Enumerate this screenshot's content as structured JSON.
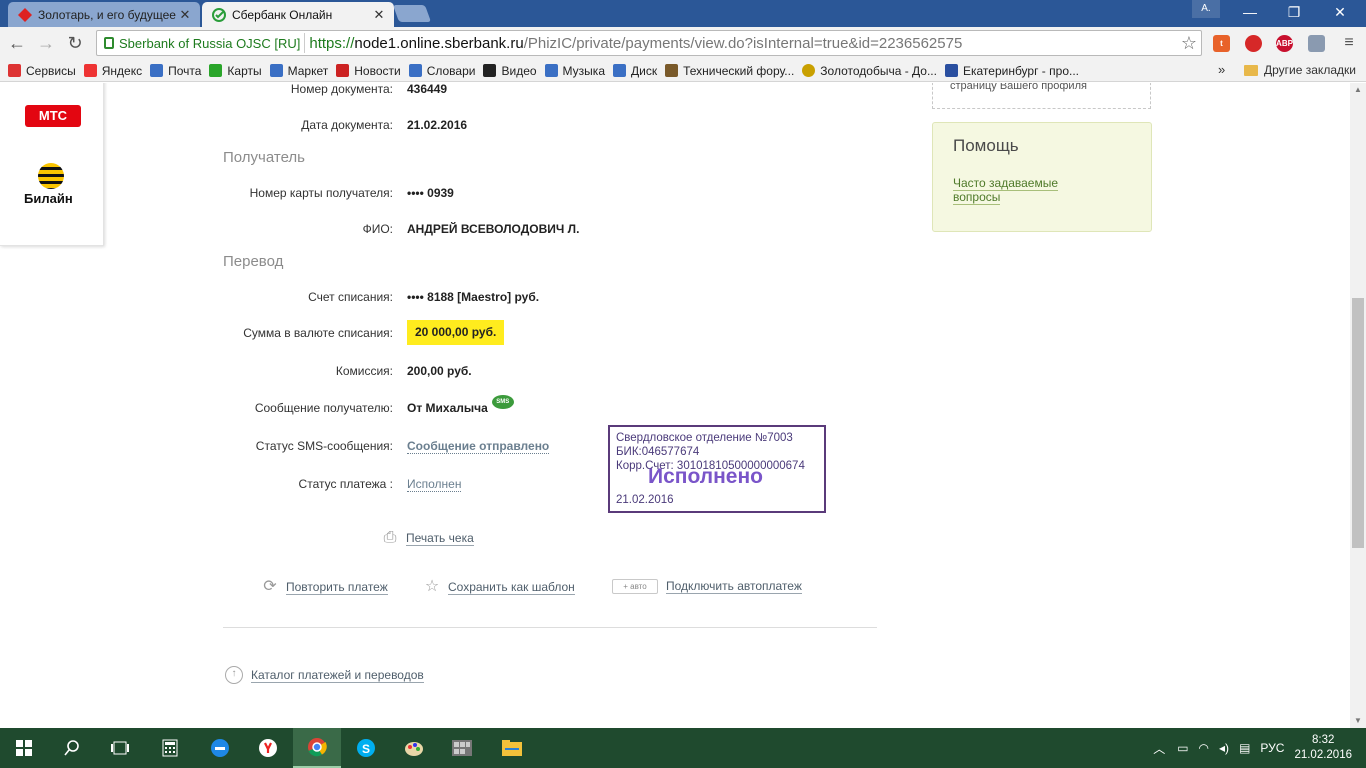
{
  "browser": {
    "tabs": [
      {
        "title": "Золотарь, и его будущее",
        "active": false
      },
      {
        "title": "Сбербанк Онлайн",
        "active": true
      }
    ],
    "profile": "A.",
    "window_controls": {
      "minimize": "—",
      "restore": "❐",
      "close": "✕"
    },
    "ev_cert": "Sberbank of Russia OJSC [RU]",
    "url": {
      "scheme": "https://",
      "host": "node1.online.sberbank.ru",
      "path": "/PhizIC/private/payments/view.do?isInternal=true&id=2236562575"
    },
    "extensions": [
      {
        "name": "t-ext-icon",
        "label": "t",
        "color": "#e8622a"
      },
      {
        "name": "shield-ext-icon",
        "label": "",
        "color": "#d62828"
      },
      {
        "name": "adblock-icon",
        "label": "ABP",
        "color": "#c8102e"
      },
      {
        "name": "mail-ext-icon",
        "label": "",
        "color": "#8a9ab0"
      }
    ],
    "bookmarks": [
      {
        "label": "Сервисы",
        "color": "#d33"
      },
      {
        "label": "Яндекс",
        "color": "#e33"
      },
      {
        "label": "Почта",
        "color": "#3a6fc4"
      },
      {
        "label": "Карты",
        "color": "#2aa52a"
      },
      {
        "label": "Маркет",
        "color": "#3a6fc4"
      },
      {
        "label": "Новости",
        "color": "#c22"
      },
      {
        "label": "Словари",
        "color": "#3a6fc4"
      },
      {
        "label": "Видео",
        "color": "#222"
      },
      {
        "label": "Музыка",
        "color": "#3a6fc4"
      },
      {
        "label": "Диск",
        "color": "#3a6fc4"
      },
      {
        "label": "Технический фору...",
        "color": "#7a5a2a"
      },
      {
        "label": "Золотодобыча - До...",
        "color": "#c9a000"
      },
      {
        "label": "Екатеринбург - про...",
        "color": "#2a4fa0"
      }
    ],
    "bookmarks_more": "»",
    "other_bookmarks": "Другие закладки"
  },
  "operators": {
    "mts": "МТС",
    "beeline": "Билайн"
  },
  "document": {
    "number_label": "Номер документа:",
    "number_value": "436449",
    "date_label": "Дата документа:",
    "date_value": "21.02.2016"
  },
  "recipient": {
    "section": "Получатель",
    "card_label": "Номер карты получателя:",
    "card_value": "•••• 0939",
    "name_label": "ФИО:",
    "name_value": "АНДРЕЙ ВСЕВОЛОДОВИЧ Л."
  },
  "transfer": {
    "section": "Перевод",
    "account_label": "Счет списания:",
    "account_value": "•••• 8188  [Maestro]  руб.",
    "amount_label": "Сумма в валюте списания:",
    "amount_value": "20 000,00  руб.",
    "fee_label": "Комиссия:",
    "fee_value": "200,00 руб.",
    "message_label": "Сообщение получателю:",
    "message_value": "От Михалыча",
    "sms_badge": "SMS",
    "sms_status_label": "Статус SMS-сообщения:",
    "sms_status_value": "Сообщение отправлено",
    "status_label": "Статус платежа :",
    "status_value": "Исполнен"
  },
  "stamp": {
    "line1": "Свердловское отделение №7003",
    "line2": "БИК:046577674",
    "line3": "Корр.Счет: 30101810500000000674",
    "big": "Исполнено",
    "date": "21.02.2016"
  },
  "actions": {
    "print": "Печать чека",
    "repeat": "Повторить платеж",
    "save_template": "Сохранить как шаблон",
    "auto_badge": "+  авто",
    "autopay": "Подключить автоплатеж",
    "catalog": "Каталог платежей и переводов"
  },
  "sidebar": {
    "profile_text": "страницу Вашего профиля",
    "help_title": "Помощь",
    "help_link": "Часто задаваемые вопросы"
  },
  "taskbar": {
    "lang": "РУС",
    "time": "8:32",
    "date": "21.02.2016"
  }
}
